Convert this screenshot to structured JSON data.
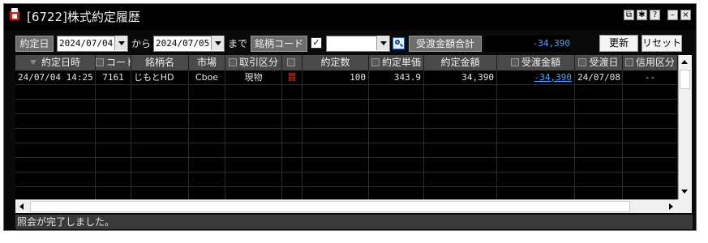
{
  "window": {
    "title": "[6722]株式約定履歴",
    "controls": [
      "restore-icon",
      "pin-icon",
      "help-icon",
      "minimize-icon",
      "close-icon"
    ],
    "control_glyphs": {
      "restore": "⧉",
      "pin": "✱",
      "help": "?",
      "minimize": "–",
      "close": "×"
    }
  },
  "toolbar": {
    "date_label": "約定日",
    "date_from": "2024/07/04",
    "from_suffix": "から",
    "date_to": "2024/07/05",
    "to_suffix": "まで",
    "code_label": "銘柄コード",
    "code_checked": "✓",
    "code_value": "",
    "total_label": "受渡金額合計",
    "total_value": "-34,390",
    "refresh_label": "更新",
    "reset_label": "リセット"
  },
  "table": {
    "headers": [
      "約定日時",
      "コード",
      "銘柄名",
      "市場",
      "取引区分",
      "",
      "約定数",
      "約定単価",
      "約定金額",
      "受渡金額",
      "受渡日",
      "信用区分"
    ],
    "rows": [
      {
        "datetime": "24/07/04 14:25",
        "code": "7161",
        "name": "じもとHD",
        "market": "Cboe",
        "trade_type": "現物",
        "side": "買",
        "quantity": "100",
        "unit_price": "343.9",
        "amount": "34,390",
        "settlement_amount": "-34,390",
        "settlement_date": "24/07/08",
        "margin_type": "--"
      }
    ]
  },
  "status": {
    "message": "照会が完了しました。"
  },
  "colors": {
    "background": "#000000",
    "header": "#4a4a4a",
    "total": "#4ea3ff",
    "buy": "#ff3030"
  }
}
